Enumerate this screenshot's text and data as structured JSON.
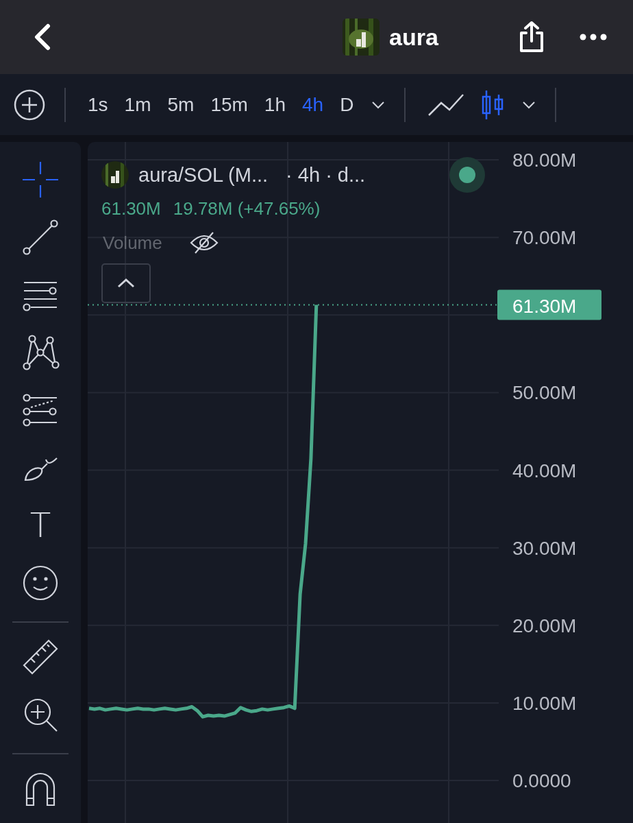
{
  "header": {
    "title": "aura"
  },
  "toolbar": {
    "timeframes": [
      {
        "label": "1s",
        "selected": false
      },
      {
        "label": "1m",
        "selected": false
      },
      {
        "label": "5m",
        "selected": false
      },
      {
        "label": "15m",
        "selected": false
      },
      {
        "label": "1h",
        "selected": false
      },
      {
        "label": "4h",
        "selected": true
      },
      {
        "label": "D",
        "selected": false
      }
    ],
    "chart_types": [
      {
        "kind": "line",
        "selected": false
      },
      {
        "kind": "candles",
        "selected": true
      }
    ]
  },
  "tool_groups": [
    [
      {
        "kind": "crosshair",
        "selected": true
      },
      {
        "kind": "trend-line",
        "selected": false
      },
      {
        "kind": "lines",
        "selected": false
      },
      {
        "kind": "pattern",
        "selected": false
      },
      {
        "kind": "fib",
        "selected": false
      },
      {
        "kind": "brush",
        "selected": false
      },
      {
        "kind": "text",
        "glyph": "T",
        "selected": false
      },
      {
        "kind": "emoji",
        "selected": false
      }
    ],
    [
      {
        "kind": "ruler",
        "selected": false
      },
      {
        "kind": "zoom",
        "selected": false
      }
    ],
    [
      {
        "kind": "magnet",
        "selected": false
      }
    ]
  ],
  "legend": {
    "symbol": "aura/SOL (M...",
    "interval": "· 4h · d...",
    "last": "61.30M",
    "change": "19.78M (+47.65%)",
    "indicator": {
      "name": "Volume",
      "visible": false
    }
  },
  "chart": {
    "chart_data": {
      "type": "line",
      "ylim": [
        0,
        80
      ],
      "grid": true,
      "values": [
        9.3,
        9.2,
        9.3,
        9.1,
        9.2,
        9.3,
        9.2,
        9.1,
        9.2,
        9.3,
        9.2,
        9.2,
        9.1,
        9.2,
        9.3,
        9.2,
        9.1,
        9.2,
        9.3,
        9.5,
        9.0,
        8.2,
        8.4,
        8.3,
        8.4,
        8.3,
        8.5,
        8.7,
        9.4,
        9.1,
        8.9,
        9.0,
        9.2,
        9.1,
        9.2,
        9.3,
        9.4,
        9.6,
        9.3,
        24.0,
        30.5,
        41.5,
        61.3
      ],
      "yticks": [
        {
          "value": 80,
          "label": "80.00M"
        },
        {
          "value": 70,
          "label": "70.00M"
        },
        {
          "value": 50,
          "label": "50.00M"
        },
        {
          "value": 40,
          "label": "40.00M"
        },
        {
          "value": 30,
          "label": "30.00M"
        },
        {
          "value": 20,
          "label": "20.00M"
        },
        {
          "value": 10,
          "label": "10.00M"
        },
        {
          "value": 0,
          "label": "0.0000"
        }
      ]
    },
    "price_label": "61.30M"
  }
}
